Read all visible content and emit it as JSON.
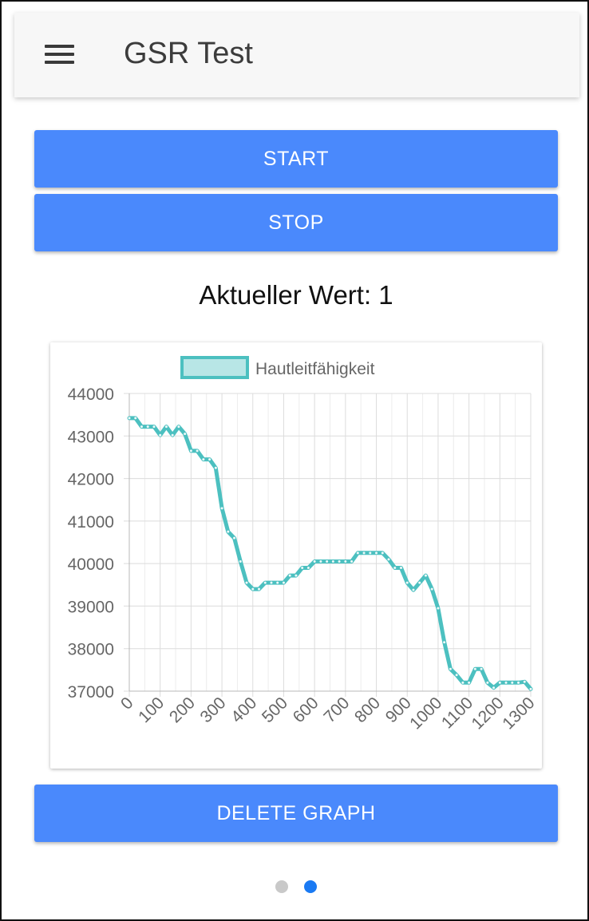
{
  "app_bar": {
    "title": "GSR Test",
    "menu_icon": "hamburger-menu-icon"
  },
  "controls": {
    "start_label": "START",
    "stop_label": "STOP",
    "delete_label": "DELETE GRAPH"
  },
  "current_value": {
    "label": "Aktueller Wert:",
    "value": "1"
  },
  "pager": {
    "count": 2,
    "active": 2
  },
  "colors": {
    "button": "#4a89fc",
    "series_line": "#4cc0c0",
    "series_fill": "#b8e6e6",
    "pager_active": "#1a7af3",
    "pager_inactive": "#c9c9c9"
  },
  "chart_data": {
    "type": "line",
    "title": "",
    "xlabel": "",
    "ylabel": "",
    "legend": "top-center",
    "grid": true,
    "xlim": [
      0,
      1300
    ],
    "ylim": [
      37000,
      44000
    ],
    "x_ticks": [
      0,
      100,
      200,
      300,
      400,
      500,
      600,
      700,
      800,
      900,
      1000,
      1100,
      1200,
      1300
    ],
    "y_ticks": [
      37000,
      38000,
      39000,
      40000,
      41000,
      42000,
      43000,
      44000
    ],
    "series": [
      {
        "name": "Hautleitfähigkeit",
        "x": [
          0,
          20,
          40,
          60,
          80,
          100,
          120,
          140,
          160,
          180,
          200,
          220,
          240,
          260,
          280,
          300,
          320,
          340,
          360,
          380,
          400,
          420,
          440,
          460,
          480,
          500,
          520,
          540,
          560,
          580,
          600,
          620,
          640,
          660,
          680,
          700,
          720,
          740,
          760,
          780,
          800,
          820,
          840,
          860,
          880,
          900,
          920,
          940,
          960,
          980,
          1000,
          1020,
          1040,
          1060,
          1080,
          1100,
          1120,
          1140,
          1160,
          1180,
          1200,
          1220,
          1240,
          1260,
          1280,
          1300
        ],
        "y": [
          43420,
          43420,
          43220,
          43220,
          43220,
          43020,
          43220,
          43020,
          43220,
          43050,
          42650,
          42650,
          42450,
          42450,
          42250,
          41300,
          40750,
          40600,
          40050,
          39550,
          39400,
          39400,
          39550,
          39550,
          39550,
          39550,
          39720,
          39720,
          39900,
          39900,
          40050,
          40050,
          40050,
          40050,
          40050,
          40050,
          40050,
          40250,
          40250,
          40250,
          40250,
          40250,
          40100,
          39900,
          39900,
          39550,
          39380,
          39550,
          39720,
          39400,
          38950,
          38150,
          37520,
          37380,
          37200,
          37200,
          37520,
          37520,
          37200,
          37080,
          37200,
          37200,
          37200,
          37200,
          37220,
          37050
        ]
      }
    ]
  }
}
